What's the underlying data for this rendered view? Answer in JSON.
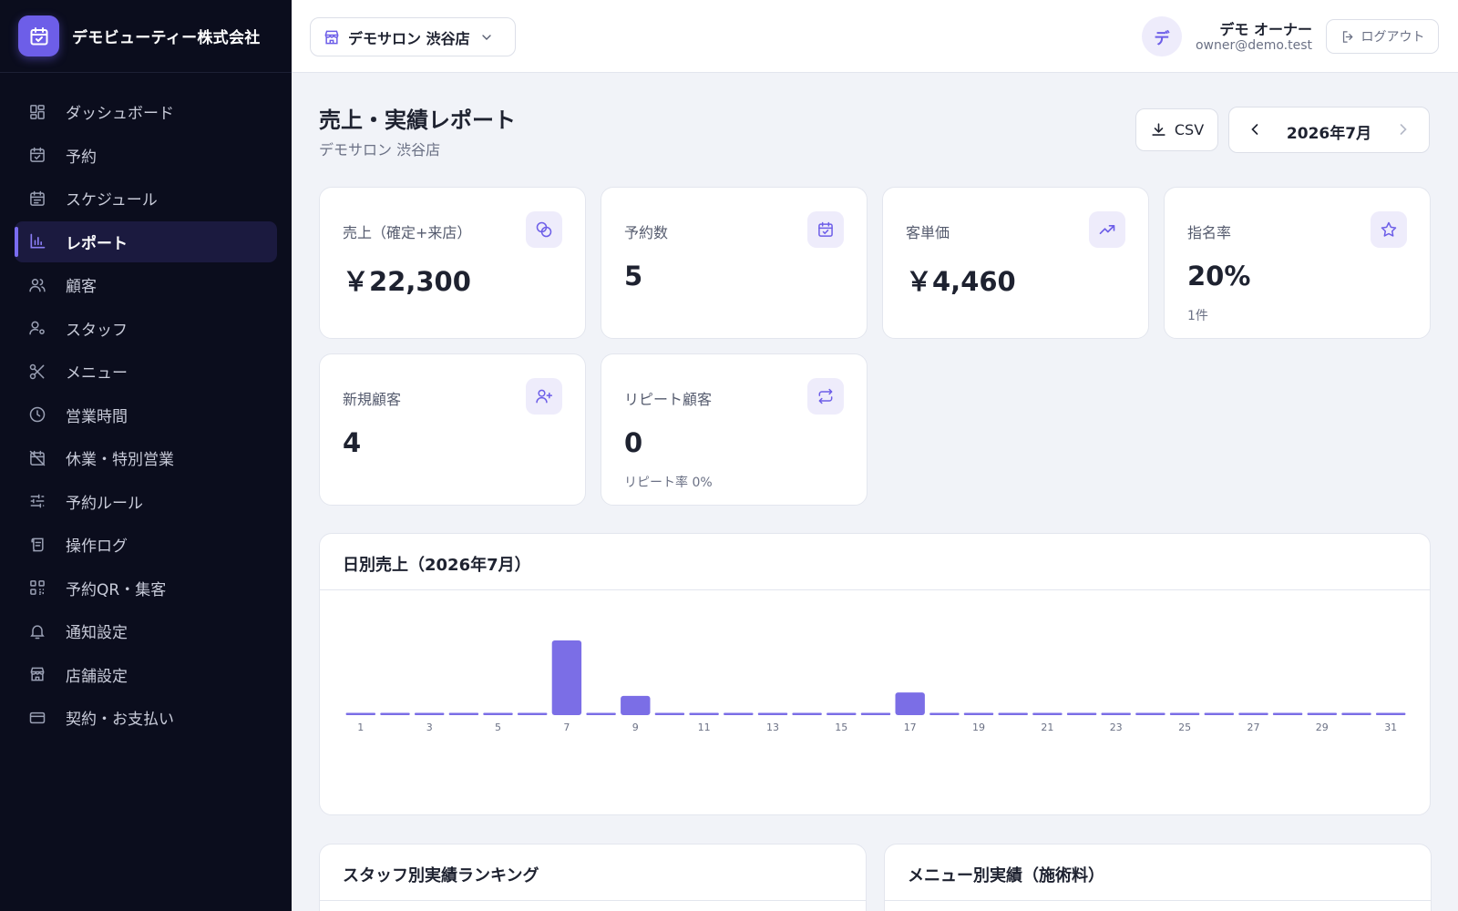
{
  "brand": {
    "name": "デモビューティー株式会社",
    "icon": "calendar-check-icon"
  },
  "sidebar": {
    "items": [
      {
        "label": "ダッシュボード",
        "icon": "dashboard-grid-icon"
      },
      {
        "label": "予約",
        "icon": "calendar-check-icon"
      },
      {
        "label": "スケジュール",
        "icon": "calendar-list-icon"
      },
      {
        "label": "レポート",
        "icon": "bar-chart-icon",
        "active": true
      },
      {
        "label": "顧客",
        "icon": "users-icon"
      },
      {
        "label": "スタッフ",
        "icon": "user-cog-icon"
      },
      {
        "label": "メニュー",
        "icon": "scissors-icon"
      },
      {
        "label": "営業時間",
        "icon": "clock-icon"
      },
      {
        "label": "休業・特別営業",
        "icon": "calendar-off-icon"
      },
      {
        "label": "予約ルール",
        "icon": "sliders-icon"
      },
      {
        "label": "操作ログ",
        "icon": "scroll-log-icon"
      },
      {
        "label": "予約QR・集客",
        "icon": "qr-code-icon"
      },
      {
        "label": "通知設定",
        "icon": "bell-icon"
      },
      {
        "label": "店舗設定",
        "icon": "store-icon"
      },
      {
        "label": "契約・お支払い",
        "icon": "credit-card-icon"
      }
    ]
  },
  "header": {
    "store_name": "デモサロン 渋谷店",
    "avatar_initial": "デ",
    "user_name": "デモ オーナー",
    "user_email": "owner@demo.test",
    "logout_label": "ログアウト"
  },
  "page": {
    "title": "売上・実績レポート",
    "subtitle": "デモサロン 渋谷店",
    "csv_label": "CSV",
    "month_label": "2026年7月"
  },
  "kpis": [
    {
      "label": "売上（確定+来店）",
      "value": "￥22,300",
      "icon": "coins-icon"
    },
    {
      "label": "予約数",
      "value": "5",
      "icon": "calendar-check-icon"
    },
    {
      "label": "客単価",
      "value": "￥4,460",
      "icon": "trending-up-icon"
    },
    {
      "label": "指名率",
      "value": "20%",
      "sub": "1件",
      "icon": "star-icon"
    },
    {
      "label": "新規顧客",
      "value": "4",
      "icon": "user-plus-icon"
    },
    {
      "label": "リピート顧客",
      "value": "0",
      "sub": "リピート率 0%",
      "icon": "repeat-icon"
    }
  ],
  "chart": {
    "title": "日別売上（2026年7月）"
  },
  "chart_data": {
    "type": "bar",
    "title": "日別売上（2026年7月）",
    "categories": [
      "1",
      "2",
      "3",
      "4",
      "5",
      "6",
      "7",
      "8",
      "9",
      "10",
      "11",
      "12",
      "13",
      "14",
      "15",
      "16",
      "17",
      "18",
      "19",
      "20",
      "21",
      "22",
      "23",
      "24",
      "25",
      "26",
      "27",
      "28",
      "29",
      "30",
      "31"
    ],
    "tick_labels": [
      "1",
      "3",
      "5",
      "7",
      "9",
      "11",
      "13",
      "15",
      "17",
      "19",
      "21",
      "23",
      "25",
      "27",
      "29",
      "31"
    ],
    "values": [
      0,
      0,
      0,
      0,
      0,
      0,
      14800,
      0,
      3800,
      0,
      0,
      0,
      0,
      0,
      0,
      0,
      4500,
      0,
      0,
      0,
      0,
      0,
      0,
      0,
      0,
      0,
      0,
      0,
      0,
      0,
      0
    ],
    "ylim": [
      0,
      14800
    ],
    "color": "#7b6ee6",
    "grid": false,
    "legend": "none"
  },
  "bottom": {
    "staff_title": "スタッフ別実績ランキング",
    "menu_title": "メニュー別実績（施術料）"
  },
  "colors": {
    "accent": "#6d5ee8",
    "sidebar_bg": "#0b0d1d",
    "bar": "#7b6ee6"
  }
}
